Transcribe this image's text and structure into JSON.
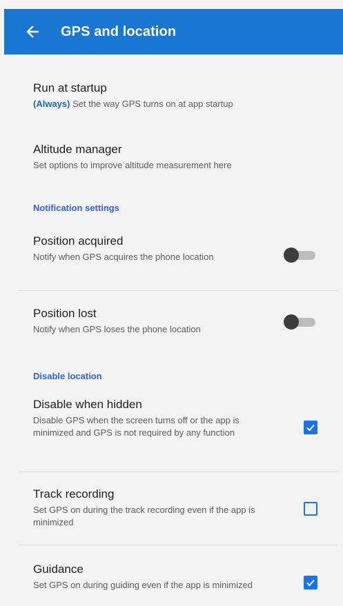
{
  "header": {
    "title": "GPS and location",
    "back_icon": "arrow-left-icon"
  },
  "colors": {
    "app_bar": "#1976d2",
    "accent": "#1565c0",
    "section_header": "#2962ff",
    "checkbox": "#1a73e8",
    "switch_off_thumb": "#3d3d3d",
    "switch_off_track": "#bdbdbd"
  },
  "prefs": {
    "run_at_startup": {
      "title": "Run at startup",
      "value": "(Always)",
      "summary": " Set the way GPS turns on at app startup"
    },
    "altitude_manager": {
      "title": "Altitude manager",
      "summary": "Set options to improve altitude measurement here"
    },
    "notification_section": "Notification settings",
    "position_acquired": {
      "title": "Position acquired",
      "summary": "Notify when GPS acquires the phone location",
      "enabled": false
    },
    "position_lost": {
      "title": "Position lost",
      "summary": "Notify when GPS loses the phone location",
      "enabled": false
    },
    "disable_section": "Disable location",
    "disable_when_hidden": {
      "title": "Disable when hidden",
      "summary": "Disable GPS when the screen turns off or the app is minimized and GPS is not required by any function",
      "checked": true
    },
    "track_recording": {
      "title": "Track recording",
      "summary": "Set GPS on during the track recording even if the app is minimized",
      "checked": false
    },
    "guidance": {
      "title": "Guidance",
      "summary": "Set GPS on during guiding even if the app is minimized",
      "checked": true
    }
  }
}
